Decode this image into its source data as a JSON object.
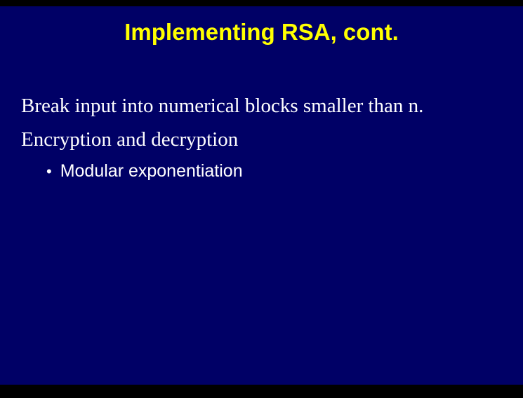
{
  "slide": {
    "title": "Implementing RSA, cont.",
    "line1": "Break input into numerical blocks smaller than n.",
    "line2": "Encryption and decryption",
    "bullet1": "Modular exponentiation"
  }
}
